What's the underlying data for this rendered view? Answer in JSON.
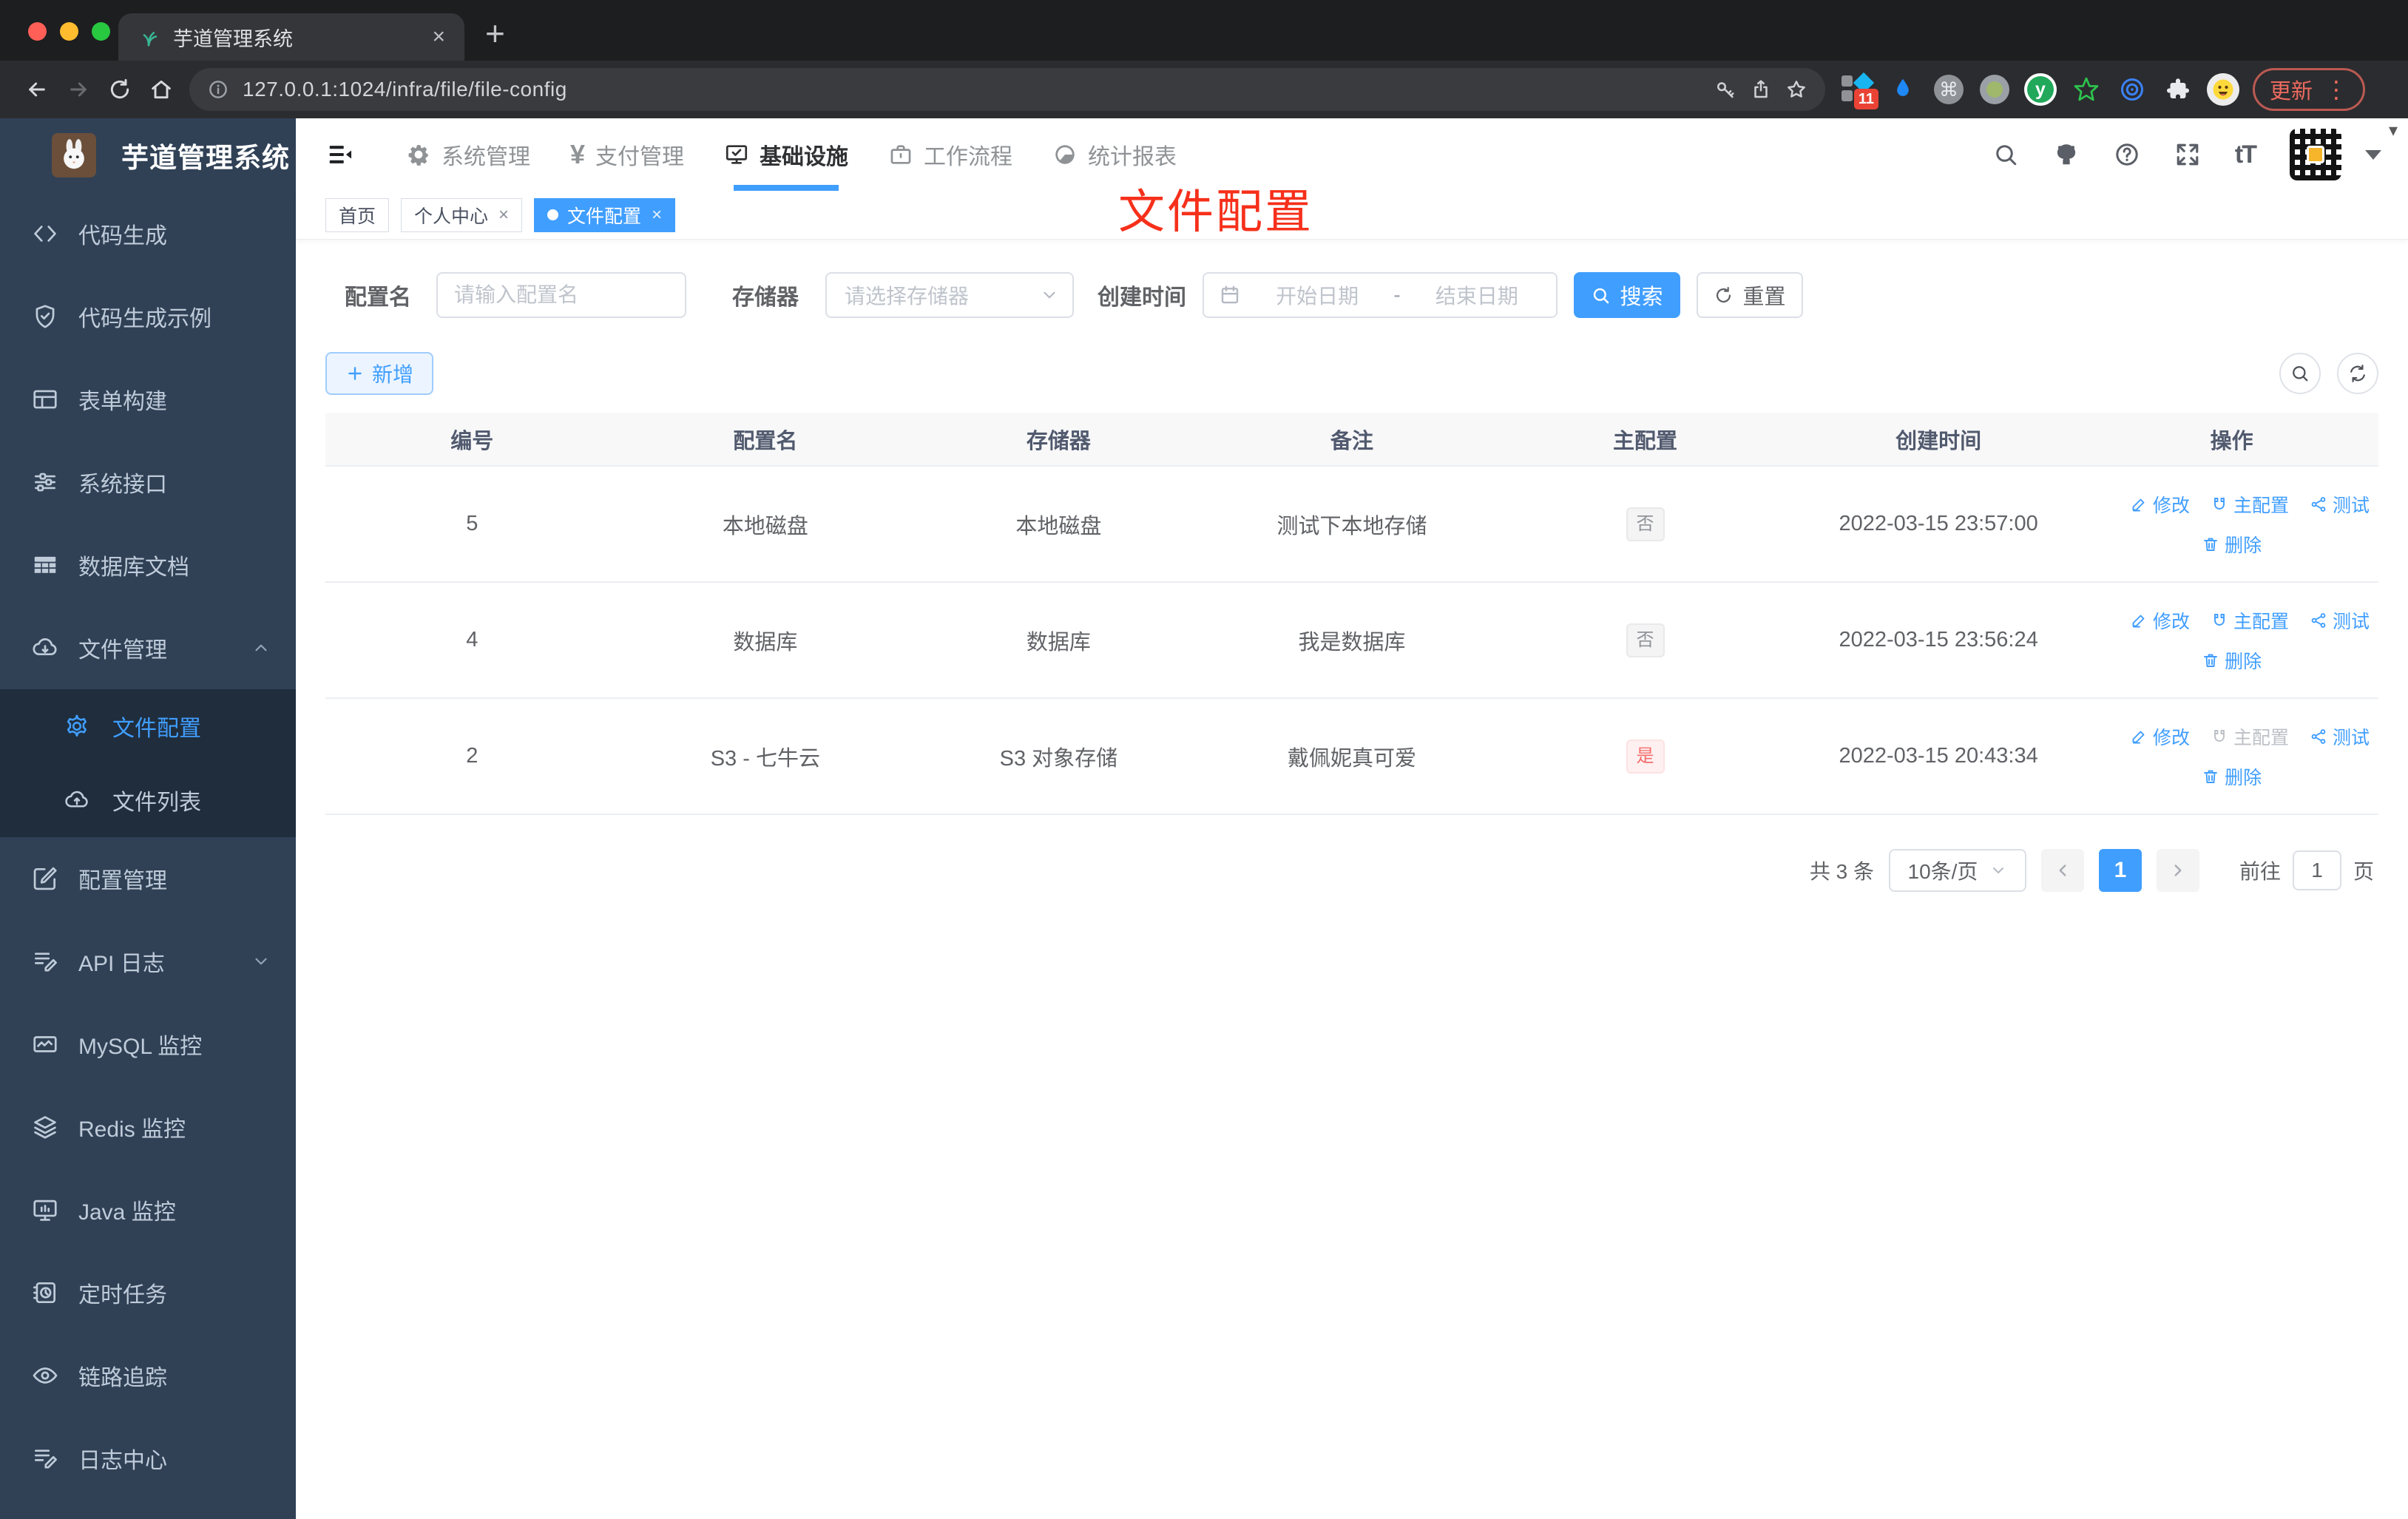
{
  "colors": {
    "primary": "#409eff",
    "annotation_red": "#f6301b",
    "sidebar_bg": "#304156",
    "submenu_bg": "#1f2d3d",
    "danger": "#f56c6c",
    "tag_info_text": "#909399"
  },
  "glyphs": {
    "close": "×",
    "plus": "+",
    "yen": "¥",
    "cmd": "⌘",
    "vdots": "⋮",
    "text_size": "tT",
    "y_letter": "y",
    "caret_down": "▾"
  },
  "browser": {
    "tab_title": "芋道管理系统",
    "url": "127.0.0.1:1024/infra/file/file-config",
    "ext_badge": "11",
    "update_label": "更新"
  },
  "sidebar": {
    "logo_title": "芋道管理系统",
    "items": [
      {
        "icon": "code-icon",
        "label": "代码生成"
      },
      {
        "icon": "shield-check-icon",
        "label": "代码生成示例"
      },
      {
        "icon": "form-icon",
        "label": "表单构建"
      },
      {
        "icon": "sliders-icon",
        "label": "系统接口"
      },
      {
        "icon": "db-table-icon",
        "label": "数据库文档"
      },
      {
        "icon": "cloud-download-icon",
        "label": "文件管理",
        "expanded": true,
        "children": [
          {
            "icon": "gear-icon",
            "label": "文件配置",
            "active": true
          },
          {
            "icon": "cloud-upload-icon",
            "label": "文件列表"
          }
        ]
      },
      {
        "icon": "edit-square-icon",
        "label": "配置管理"
      },
      {
        "icon": "log-icon",
        "label": "API 日志",
        "collapsed": true
      },
      {
        "icon": "chart-icon",
        "label": "MySQL 监控"
      },
      {
        "icon": "layers-icon",
        "label": "Redis 监控"
      },
      {
        "icon": "monitor-icon",
        "label": "Java 监控"
      },
      {
        "icon": "timer-icon",
        "label": "定时任务"
      },
      {
        "icon": "eye-icon",
        "label": "链路追踪"
      },
      {
        "icon": "log-icon",
        "label": "日志中心"
      }
    ]
  },
  "topnav": {
    "items": [
      {
        "icon": "gear-icon",
        "label": "系统管理"
      },
      {
        "icon": "yen-icon",
        "label": "支付管理"
      },
      {
        "icon": "infra-monitor-icon",
        "label": "基础设施",
        "active": true
      },
      {
        "icon": "briefcase-icon",
        "label": "工作流程"
      },
      {
        "icon": "report-icon",
        "label": "统计报表"
      }
    ]
  },
  "tags": [
    {
      "label": "首页",
      "closable": false,
      "active": false
    },
    {
      "label": "个人中心",
      "closable": true,
      "active": false
    },
    {
      "label": "文件配置",
      "closable": true,
      "active": true
    }
  ],
  "annotation": {
    "text": "文件配置"
  },
  "filters": {
    "name_label": "配置名",
    "name_placeholder": "请输入配置名",
    "storage_label": "存储器",
    "storage_placeholder": "请选择存储器",
    "date_label": "创建时间",
    "date_start": "开始日期",
    "date_separator": "-",
    "date_end": "结束日期",
    "search_label": "搜索",
    "reset_label": "重置",
    "add_label": "新增"
  },
  "table": {
    "headers": [
      "编号",
      "配置名",
      "存储器",
      "备注",
      "主配置",
      "创建时间",
      "操作"
    ],
    "action_labels": {
      "edit": "修改",
      "master": "主配置",
      "test": "测试",
      "delete": "删除"
    },
    "rows": [
      {
        "id": "5",
        "name": "本地磁盘",
        "storage": "本地磁盘",
        "remark": "测试下本地存储",
        "master": "否",
        "master_type": "info",
        "created": "2022-03-15 23:57:00",
        "master_action_disabled": false
      },
      {
        "id": "4",
        "name": "数据库",
        "storage": "数据库",
        "remark": "我是数据库",
        "master": "否",
        "master_type": "info",
        "created": "2022-03-15 23:56:24",
        "master_action_disabled": false
      },
      {
        "id": "2",
        "name": "S3 - 七牛云",
        "storage": "S3 对象存储",
        "remark": "戴佩妮真可爱",
        "master": "是",
        "master_type": "danger",
        "created": "2022-03-15 20:43:34",
        "master_action_disabled": true
      }
    ]
  },
  "pagination": {
    "total": "共 3 条",
    "page_size": "10条/页",
    "current_page": "1",
    "goto_label": "前往",
    "goto_value": "1",
    "page_unit": "页"
  }
}
